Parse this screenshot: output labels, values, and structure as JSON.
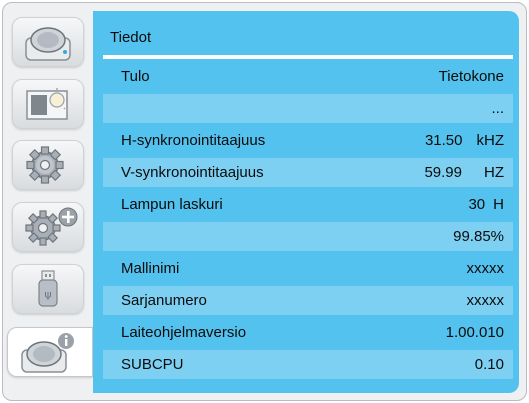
{
  "panel": {
    "title": "Tiedot",
    "rows": [
      {
        "label": "Tulo",
        "value": "Tietokone",
        "unit": ""
      },
      {
        "label": "",
        "value": "...",
        "unit": ""
      },
      {
        "label": "H-synkronointitaajuus",
        "value": "31.50",
        "unit": "kHZ"
      },
      {
        "label": "V-synkronointitaajuus",
        "value": "59.99",
        "unit": "HZ"
      },
      {
        "label": "Lampun laskuri",
        "value": "30",
        "unit": "H"
      },
      {
        "label": "",
        "value": "99.85%",
        "unit": ""
      },
      {
        "label": "Mallinimi",
        "value": "xxxxx",
        "unit": ""
      },
      {
        "label": "Sarjanumero",
        "value": "xxxxx",
        "unit": ""
      },
      {
        "label": "Laiteohjelmaversio",
        "value": "1.00.010",
        "unit": ""
      },
      {
        "label": "SUBCPU",
        "value": "0.10",
        "unit": ""
      }
    ]
  },
  "sidebar": {
    "items": [
      {
        "icon": "camera-icon",
        "active": false
      },
      {
        "icon": "picture-brightness-icon",
        "active": false
      },
      {
        "icon": "gear-icon",
        "active": false
      },
      {
        "icon": "gear-plus-icon",
        "active": false
      },
      {
        "icon": "usb-icon",
        "active": false
      },
      {
        "icon": "camera-info-icon",
        "active": true
      }
    ]
  },
  "colors": {
    "panel": "#54c2ee",
    "panel_alt_row": "#7dd0f2",
    "frame": "#eef0f2"
  }
}
